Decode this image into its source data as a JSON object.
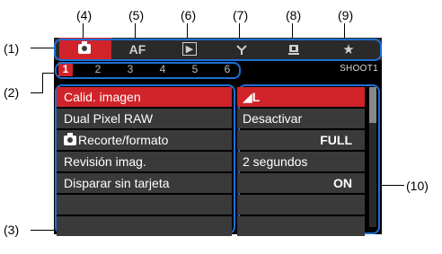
{
  "callouts": [
    "(1)",
    "(2)",
    "(3)",
    "(4)",
    "(5)",
    "(6)",
    "(7)",
    "(8)",
    "(9)",
    "(10)"
  ],
  "tabs": [
    {
      "name": "tab-shooting",
      "icon": "camera-icon",
      "label": ""
    },
    {
      "name": "tab-af",
      "icon": "af-icon",
      "label": "AF"
    },
    {
      "name": "tab-playback",
      "icon": "play-icon",
      "label": "▶"
    },
    {
      "name": "tab-wireless",
      "icon": "wireless-icon",
      "label": ""
    },
    {
      "name": "tab-setup",
      "icon": "wrench-icon",
      "label": ""
    },
    {
      "name": "tab-mymenu",
      "icon": "star-icon",
      "label": "★"
    }
  ],
  "subpages": [
    "1",
    "2",
    "3",
    "4",
    "5",
    "6"
  ],
  "page_id": "SHOOT1",
  "menu": [
    {
      "label": "Calid. imagen",
      "value": "◢L",
      "align": "left",
      "selected": true
    },
    {
      "label": "Dual Pixel RAW",
      "value": "Desactivar",
      "align": "left",
      "selected": false
    },
    {
      "label": "Recorte/formato",
      "value": "FULL",
      "align": "right",
      "selected": false
    },
    {
      "label": "Revisión imag.",
      "value": "2 segundos",
      "align": "left",
      "selected": false
    },
    {
      "label": "Disparar sin tarjeta",
      "value": "ON",
      "align": "right",
      "selected": false
    }
  ],
  "colors": {
    "accent": "#d0232a",
    "frame": "#1e6fd6"
  }
}
